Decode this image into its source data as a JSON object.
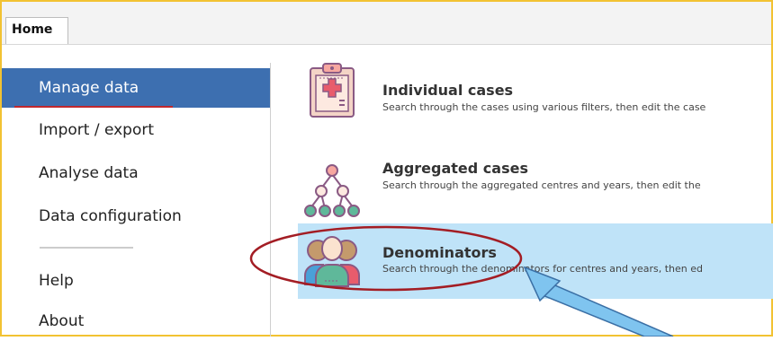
{
  "tabs": {
    "home": "Home"
  },
  "sidebar": {
    "items": [
      {
        "label": "Manage data"
      },
      {
        "label": "Import / export"
      },
      {
        "label": "Analyse data"
      },
      {
        "label": "Data configuration"
      },
      {
        "label": "Help"
      },
      {
        "label": "About"
      }
    ]
  },
  "cards": [
    {
      "title": "Individual cases",
      "description": "Search through the cases using various filters, then edit the case",
      "icon": "clipboard-medical-icon"
    },
    {
      "title": "Aggregated cases",
      "description": "Search through the aggregated centres and years, then edit the",
      "icon": "hierarchy-icon"
    },
    {
      "title": "Denominators",
      "description": "Search through the denominators for centres and years, then ed",
      "icon": "people-group-icon"
    }
  ],
  "colors": {
    "frame": "#f2c232",
    "sidebar_active": "#3d6fb0",
    "selected_card": "#bfe3f8",
    "annotation_ellipse": "#a31d24",
    "annotation_arrow": "#7fc4ef"
  }
}
